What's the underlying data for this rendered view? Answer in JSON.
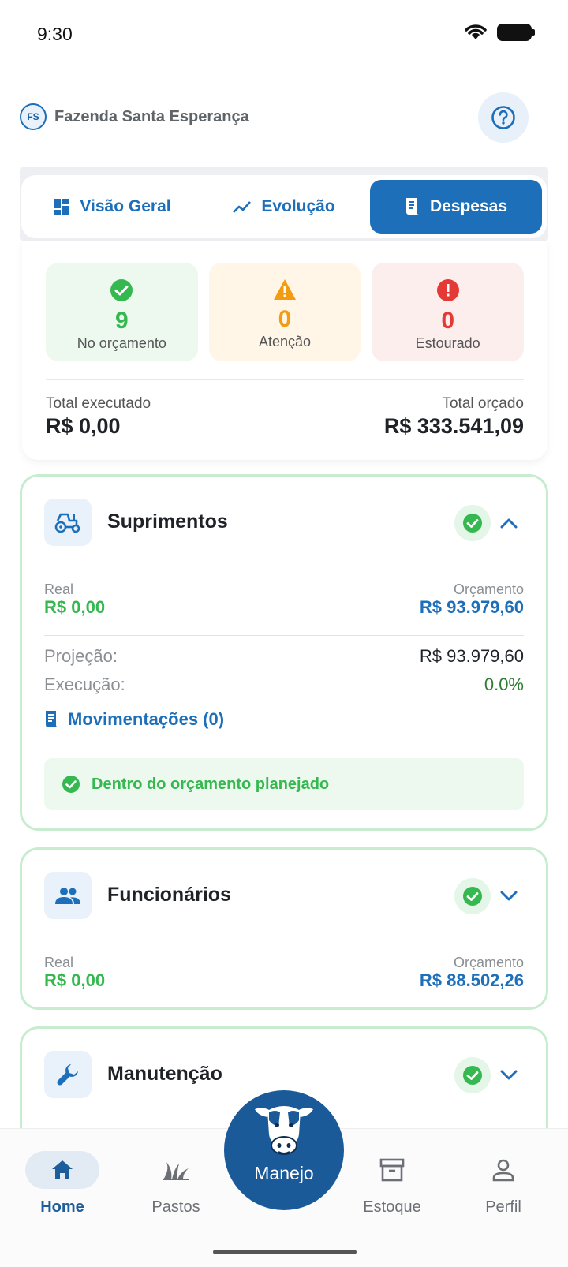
{
  "status_bar": {
    "time": "9:30"
  },
  "header": {
    "farm_initials": "FS",
    "farm_name": "Fazenda Santa Esperança"
  },
  "tabs": [
    {
      "label": "Visão Geral",
      "icon": "dashboard-icon",
      "active": false
    },
    {
      "label": "Evolução",
      "icon": "trending-up-icon",
      "active": false
    },
    {
      "label": "Despesas",
      "icon": "receipt-icon",
      "active": true
    }
  ],
  "summary": {
    "ok": {
      "count": "9",
      "label": "No orçamento",
      "color": "#35b84f"
    },
    "warn": {
      "count": "0",
      "label": "Atenção",
      "color": "#f39c12"
    },
    "bad": {
      "count": "0",
      "label": "Estourado",
      "color": "#e53935"
    },
    "executed_label": "Total executado",
    "executed_value": "R$ 0,00",
    "budget_label": "Total orçado",
    "budget_value": "R$ 333.541,09"
  },
  "categories": [
    {
      "title": "Suprimentos",
      "icon": "tractor-icon",
      "expanded": true,
      "real_label": "Real",
      "real_value": "R$ 0,00",
      "budget_label": "Orçamento",
      "budget_value": "R$ 93.979,60",
      "projection_label": "Projeção:",
      "projection_value": "R$ 93.979,60",
      "execution_label": "Execução:",
      "execution_value": "0.0%",
      "movements_label": "Movimentações (0)",
      "status_message": "Dentro do orçamento planejado"
    },
    {
      "title": "Funcionários",
      "icon": "people-icon",
      "expanded": false,
      "real_label": "Real",
      "real_value": "R$ 0,00",
      "budget_label": "Orçamento",
      "budget_value": "R$ 88.502,26"
    },
    {
      "title": "Manutenção",
      "icon": "wrench-icon",
      "expanded": false
    }
  ],
  "nav": {
    "home": "Home",
    "pastures": "Pastos",
    "fab": "Manejo",
    "stock": "Estoque",
    "profile": "Perfil"
  },
  "colors": {
    "primary": "#1e6fb9",
    "success": "#35b84f",
    "warning": "#f39c12",
    "danger": "#e53935"
  }
}
